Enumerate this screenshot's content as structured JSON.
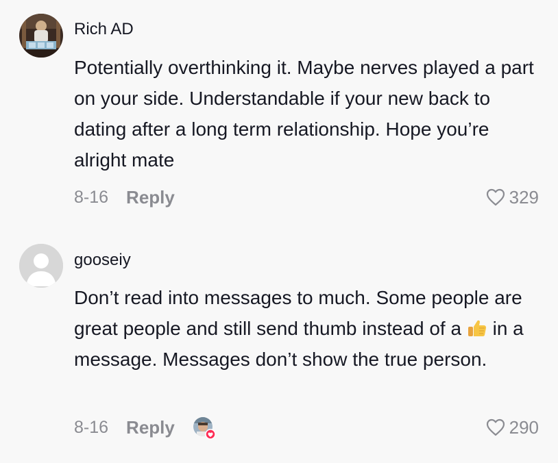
{
  "comments": [
    {
      "username": "Rich AD",
      "text": "Potentially overthinking it. Maybe nerves played a part on your side. Understandable if your new back to dating after a long term relationship. Hope you’re alright mate",
      "date": "8-16",
      "reply_label": "Reply",
      "like_count": "329"
    },
    {
      "username": "gooseiy",
      "text_before_emoji": "Don’t read into messages to much. Some people are great people and still send thumb instead of a ",
      "emoji_name": "thumbs-up-emoji",
      "text_after_emoji": " in a message. Messages don’t show the true person.",
      "date": "8-16",
      "reply_label": "Reply",
      "like_count": "290",
      "creator_liked": true
    }
  ],
  "colors": {
    "background": "#f8f8f8",
    "text_primary": "#161823",
    "text_secondary": "#8a8b91",
    "heart_badge": "#fe2c55",
    "default_avatar": "#d7d7d7"
  }
}
